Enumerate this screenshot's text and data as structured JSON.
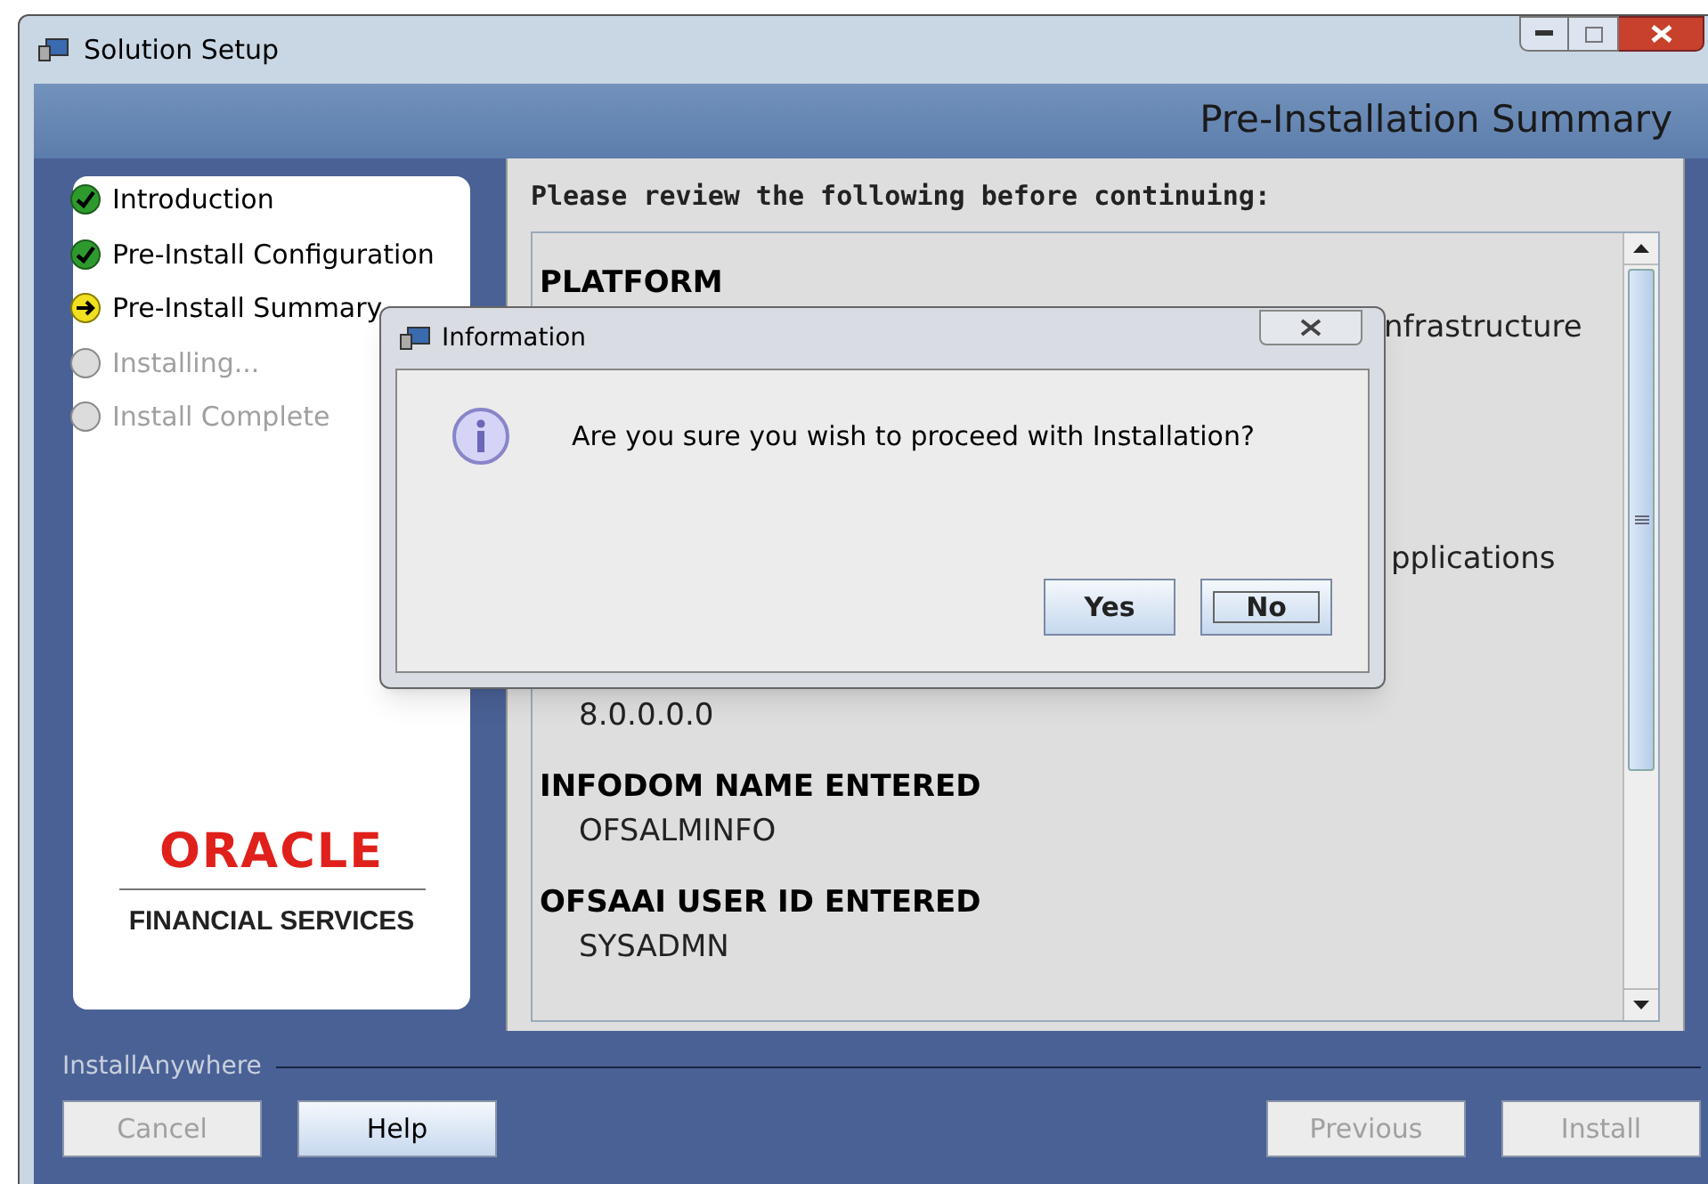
{
  "window": {
    "title": "Solution Setup"
  },
  "header": {
    "title": "Pre-Installation Summary"
  },
  "steps": [
    {
      "label": "Introduction",
      "done": true,
      "current": false
    },
    {
      "label": "Pre-Install Configuration",
      "done": true,
      "current": false
    },
    {
      "label": "Pre-Install Summary",
      "done": false,
      "current": true
    },
    {
      "label": "Installing...",
      "done": false,
      "current": false
    },
    {
      "label": "Install Complete",
      "done": false,
      "current": false
    }
  ],
  "logo": {
    "brand": "ORACLE",
    "subtitle": "FINANCIAL SERVICES"
  },
  "summary": {
    "intro": "Please review the following before continuing:",
    "lines": [
      {
        "kind": "heading",
        "text": "PLATFORM"
      },
      {
        "kind": "fragment",
        "text": "nfrastructure"
      },
      {
        "kind": "fragment",
        "text": "pplications"
      },
      {
        "kind": "value",
        "text": "8.0.0.0.0"
      },
      {
        "kind": "heading",
        "text": "INFODOM NAME ENTERED"
      },
      {
        "kind": "value",
        "text": "OFSALMINFO"
      },
      {
        "kind": "heading",
        "text": "OFSAAI USER ID ENTERED"
      },
      {
        "kind": "value",
        "text": "SYSADMN"
      }
    ]
  },
  "footer": {
    "label": "InstallAnywhere",
    "buttons": [
      {
        "label": "Cancel",
        "disabled": true
      },
      {
        "label": "Help",
        "disabled": false
      },
      {
        "label": "Previous",
        "disabled": true
      },
      {
        "label": "Install",
        "disabled": true
      }
    ]
  },
  "dialog": {
    "title": "Information",
    "message": "Are you sure you wish to proceed with Installation?",
    "buttons": [
      {
        "label": "Yes",
        "focused": false
      },
      {
        "label": "No",
        "focused": true
      }
    ]
  }
}
